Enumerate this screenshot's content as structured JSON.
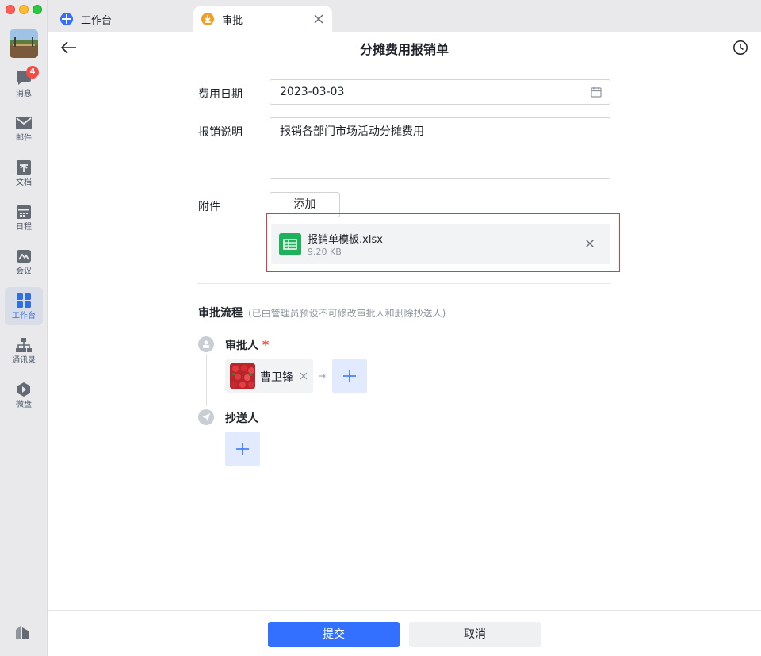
{
  "sidebar": {
    "items": [
      {
        "label": "消息",
        "icon": "chat-icon",
        "badge": "4"
      },
      {
        "label": "邮件",
        "icon": "mail-icon"
      },
      {
        "label": "文档",
        "icon": "docs-icon"
      },
      {
        "label": "日程",
        "icon": "calendar-icon"
      },
      {
        "label": "会议",
        "icon": "meeting-icon"
      },
      {
        "label": "工作台",
        "icon": "workplace-icon"
      },
      {
        "label": "通讯录",
        "icon": "contacts-icon"
      },
      {
        "label": "微盘",
        "icon": "drive-icon"
      }
    ]
  },
  "tabs": [
    {
      "label": "工作台",
      "icon": "workplace-tab-icon"
    },
    {
      "label": "审批",
      "icon": "approval-tab-icon"
    }
  ],
  "header": {
    "title": "分摊费用报销单"
  },
  "form": {
    "date_label": "费用日期",
    "date_value": "2023-03-03",
    "desc_label": "报销说明",
    "desc_value": "报销各部门市场活动分摊费用",
    "attach_label": "附件",
    "add_label": "添加",
    "attachment": {
      "name": "报销单模板.xlsx",
      "size": "9.20 KB"
    }
  },
  "flow": {
    "title": "审批流程",
    "note": "(已由管理员预设不可修改审批人和删除抄送人)",
    "approver_label": "审批人",
    "required_mark": "*",
    "approver_name": "曹卫锋",
    "cc_label": "抄送人"
  },
  "footer": {
    "submit": "提交",
    "cancel": "取消"
  },
  "colors": {
    "accent": "#3370ff",
    "highlight": "#e03a3a",
    "badge": "#f54a45",
    "excel": "#1fb25a"
  }
}
